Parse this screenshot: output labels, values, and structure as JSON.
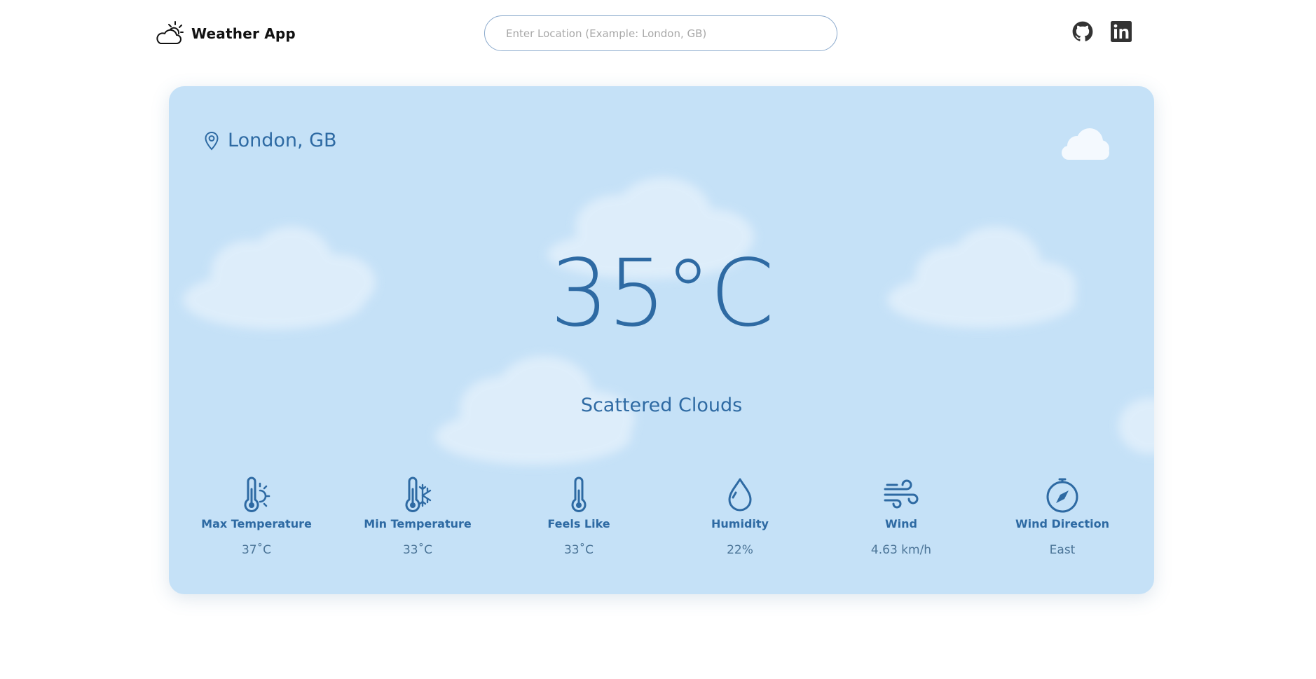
{
  "app": {
    "title": "Weather App",
    "brand_icon": "partly-cloudy-icon"
  },
  "search": {
    "placeholder": "Enter Location (Example: London, GB)",
    "value": ""
  },
  "social": {
    "github_icon": "github-icon",
    "linkedin_icon": "linkedin-icon"
  },
  "weather": {
    "location": "London, GB",
    "temperature": "35°C",
    "condition": "Scattered Clouds",
    "condition_icon": "cloud-icon"
  },
  "stats": [
    {
      "label": "Max Temperature",
      "value": "37˚C",
      "icon": "thermometer-hot-icon"
    },
    {
      "label": "Min Temperature",
      "value": "33˚C",
      "icon": "thermometer-cold-icon"
    },
    {
      "label": "Feels Like",
      "value": "33˚C",
      "icon": "thermometer-icon"
    },
    {
      "label": "Humidity",
      "value": "22%",
      "icon": "droplet-icon"
    },
    {
      "label": "Wind",
      "value": "4.63 km/h",
      "icon": "wind-icon"
    },
    {
      "label": "Wind Direction",
      "value": "East",
      "icon": "compass-icon"
    }
  ],
  "colors": {
    "accent": "#2e6aa3",
    "card_background": "#c5e1f7",
    "value_text": "#4c7598",
    "search_border": "#8aa9cc"
  }
}
